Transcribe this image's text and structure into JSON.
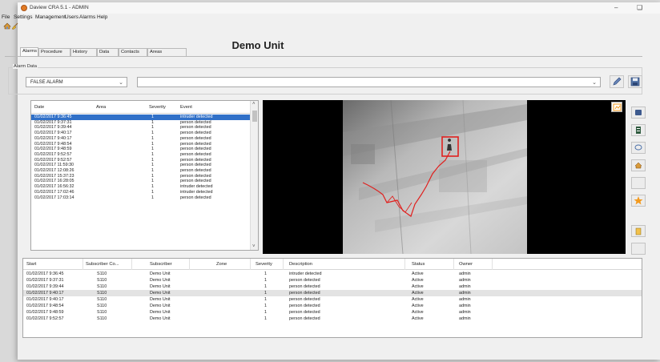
{
  "window": {
    "title": "Daview CRA 5.1 - ADMIN",
    "minimize_glyph": "–",
    "restore_glyph": "❏"
  },
  "menu": [
    "File",
    "Settings",
    "Management",
    "Users",
    "Alarms",
    "Help"
  ],
  "toolbar_icons": [
    "home-icon",
    "broom-icon"
  ],
  "page_title": "Demo Unit",
  "tabs": [
    "Alarms",
    "Procedure",
    "History",
    "Data",
    "Contacts",
    "Areas"
  ],
  "active_tab": "Alarms",
  "alarm_data": {
    "legend": "Alarm Data",
    "category_value": "FALSE ALARM",
    "notes_value": ""
  },
  "alarm_list": {
    "columns": [
      "Date",
      "Area",
      "Severity",
      "Event"
    ],
    "rows": [
      {
        "date": "01/02/2017 9:36:45",
        "area": "",
        "severity": "1",
        "event": "intruder detected",
        "selected": true
      },
      {
        "date": "01/02/2017 9:37:31",
        "area": "",
        "severity": "1",
        "event": "person detected"
      },
      {
        "date": "01/02/2017 9:39:44",
        "area": "",
        "severity": "1",
        "event": "person detected"
      },
      {
        "date": "01/02/2017 9:40:17",
        "area": "",
        "severity": "1",
        "event": "person detected"
      },
      {
        "date": "01/02/2017 9:40:17",
        "area": "",
        "severity": "1",
        "event": "person detected"
      },
      {
        "date": "01/02/2017 9:48:54",
        "area": "",
        "severity": "1",
        "event": "person detected"
      },
      {
        "date": "01/02/2017 9:48:59",
        "area": "",
        "severity": "1",
        "event": "person detected"
      },
      {
        "date": "01/02/2017 9:52:57",
        "area": "",
        "severity": "1",
        "event": "person detected"
      },
      {
        "date": "01/02/2017 9:52:57",
        "area": "",
        "severity": "1",
        "event": "person detected"
      },
      {
        "date": "01/02/2017 11:59:30",
        "area": "",
        "severity": "1",
        "event": "person detected"
      },
      {
        "date": "01/02/2017 12:08:26",
        "area": "",
        "severity": "1",
        "event": "person detected"
      },
      {
        "date": "01/02/2017 15:37:23",
        "area": "",
        "severity": "1",
        "event": "person detected"
      },
      {
        "date": "01/02/2017 16:28:05",
        "area": "",
        "severity": "1",
        "event": "person detected"
      },
      {
        "date": "01/02/2017 16:56:32",
        "area": "",
        "severity": "1",
        "event": "intruder detected"
      },
      {
        "date": "01/02/2017 17:02:46",
        "area": "",
        "severity": "1",
        "event": "intruder detected"
      },
      {
        "date": "01/02/2017 17:03:14",
        "area": "",
        "severity": "1",
        "event": "person detected"
      }
    ]
  },
  "bottom_table": {
    "columns": [
      "Start",
      "Subscriber Co...",
      "Subscriber",
      "Zone",
      "Severity",
      "Description",
      "Status",
      "Owner"
    ],
    "rows": [
      {
        "start": "01/02/2017 9:36:45",
        "code": "S110",
        "subscriber": "Demo Unit",
        "zone": "",
        "severity": "1",
        "description": "intruder detected",
        "status": "Active",
        "owner": "admin"
      },
      {
        "start": "01/02/2017 9:37:31",
        "code": "S110",
        "subscriber": "Demo Unit",
        "zone": "",
        "severity": "1",
        "description": "person detected",
        "status": "Active",
        "owner": "admin"
      },
      {
        "start": "01/02/2017 9:39:44",
        "code": "S110",
        "subscriber": "Demo Unit",
        "zone": "",
        "severity": "1",
        "description": "person detected",
        "status": "Active",
        "owner": "admin"
      },
      {
        "start": "01/02/2017 9:40:17",
        "code": "S110",
        "subscriber": "Demo Unit",
        "zone": "",
        "severity": "1",
        "description": "person detected",
        "status": "Active",
        "owner": "admin",
        "highlighted": true
      },
      {
        "start": "01/02/2017 9:40:17",
        "code": "S110",
        "subscriber": "Demo Unit",
        "zone": "",
        "severity": "1",
        "description": "person detected",
        "status": "Active",
        "owner": "admin"
      },
      {
        "start": "01/02/2017 9:48:54",
        "code": "S110",
        "subscriber": "Demo Unit",
        "zone": "",
        "severity": "1",
        "description": "person detected",
        "status": "Active",
        "owner": "admin"
      },
      {
        "start": "01/02/2017 9:48:59",
        "code": "S110",
        "subscriber": "Demo Unit",
        "zone": "",
        "severity": "1",
        "description": "person detected",
        "status": "Active",
        "owner": "admin"
      },
      {
        "start": "01/02/2017 9:52:57",
        "code": "S110",
        "subscriber": "Demo Unit",
        "zone": "",
        "severity": "1",
        "description": "person detected",
        "status": "Active",
        "owner": "admin"
      }
    ]
  },
  "colors": {
    "selection": "#3070c8",
    "detection_box": "#e0201e",
    "track_line": "#e0201e",
    "accent_orange": "#f39a1e"
  }
}
